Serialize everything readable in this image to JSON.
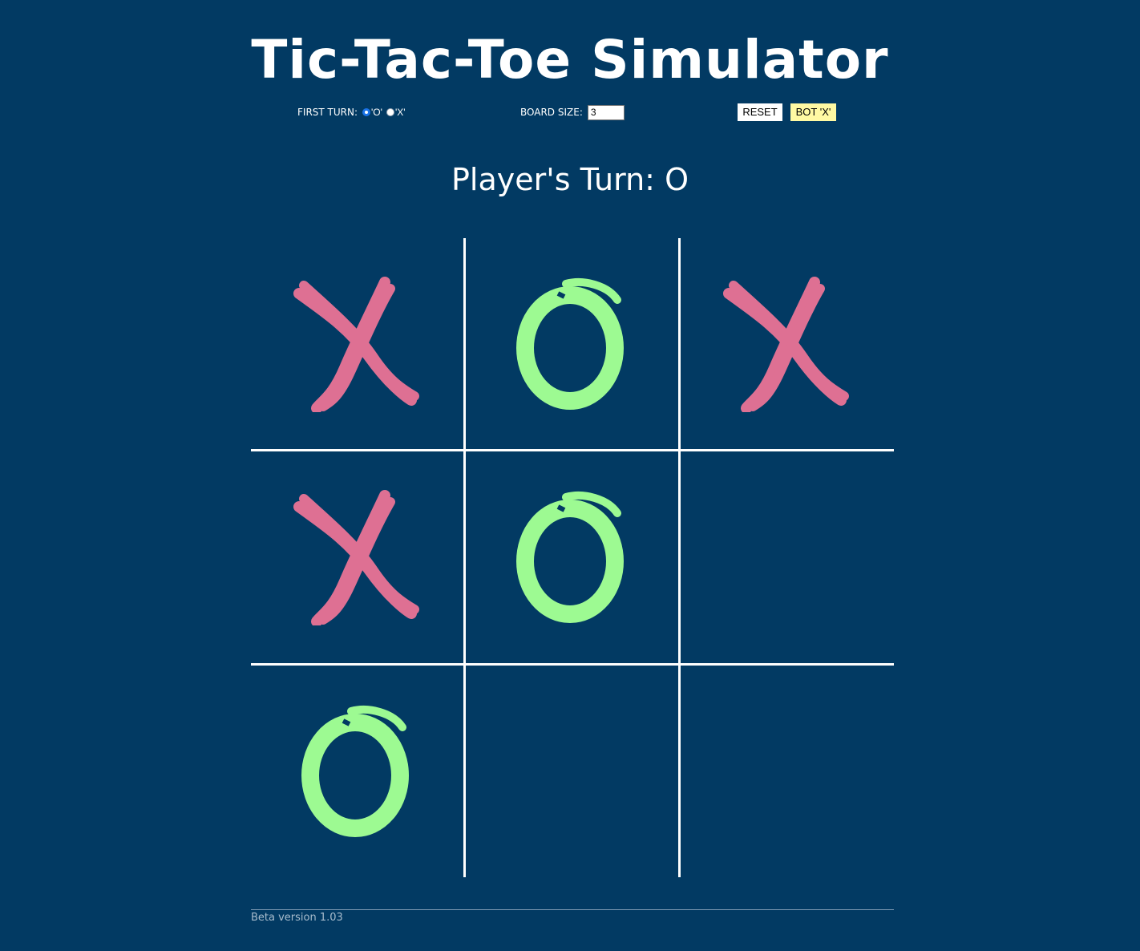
{
  "title": "Tic-Tac-Toe Simulator",
  "controls": {
    "first_turn_label": "FIRST TURN:",
    "first_turn_options": [
      "'O'",
      "'X'"
    ],
    "first_turn_selected": "'O'",
    "board_size_label": "BOARD SIZE:",
    "board_size_value": "3",
    "reset_label": "RESET",
    "bot_label": "BOT 'X'"
  },
  "status": {
    "prefix": "Player's Turn:",
    "player": "O"
  },
  "board": {
    "size": 3,
    "cells": [
      "X",
      "O",
      "X",
      "X",
      "O",
      "",
      "O",
      "",
      ""
    ]
  },
  "colors": {
    "background": "#023a63",
    "x_mark": "#de7093",
    "o_mark": "#9dfa92",
    "bot_button": "#fff9a3"
  },
  "footer": {
    "version": "Beta version 1.03"
  }
}
